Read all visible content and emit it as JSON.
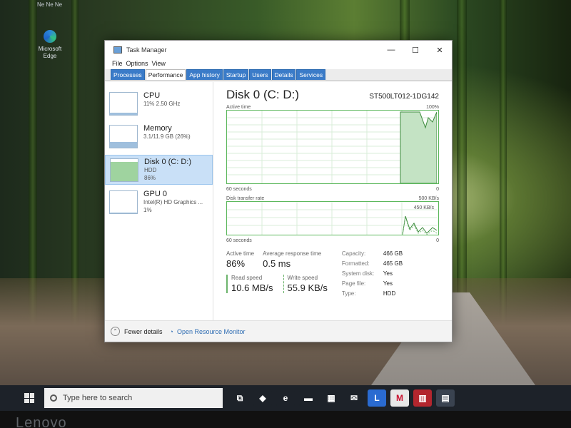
{
  "desktop": {
    "ghost_text": "Ne Ne Ne",
    "icon_label": "Microsoft Edge"
  },
  "window": {
    "title": "Task Manager",
    "controls": [
      "—",
      "☐",
      "✕"
    ],
    "menu": [
      "File",
      "Options",
      "View"
    ],
    "tabs": [
      {
        "label": "Processes"
      },
      {
        "label": "Performance",
        "active": true
      },
      {
        "label": "App history"
      },
      {
        "label": "Startup"
      },
      {
        "label": "Users"
      },
      {
        "label": "Details"
      },
      {
        "label": "Services"
      }
    ]
  },
  "resources": [
    {
      "name": "CPU",
      "line1": "11% 2.50 GHz",
      "line2": "",
      "level": 0.11
    },
    {
      "name": "Memory",
      "line1": "3.1/11.9 GB (26%)",
      "line2": "",
      "level": 0.26
    },
    {
      "name": "Disk 0 (C: D:)",
      "line1": "HDD",
      "line2": "86%",
      "level": 0.86,
      "selected": true
    },
    {
      "name": "GPU 0",
      "line1": "Intel(R) HD Graphics ...",
      "line2": "1%",
      "level": 0.01
    }
  ],
  "detail": {
    "title": "Disk 0 (C: D:)",
    "model": "ST500LT012-1DG142",
    "graph1": {
      "label": "Active time",
      "max_label": "100%",
      "left_label": "60 seconds",
      "right_label": "0"
    },
    "graph2": {
      "label": "Disk transfer rate",
      "max_label": "500 KB/s",
      "inner_label": "450 KB/s",
      "left_label": "60 seconds",
      "right_label": "0"
    },
    "active_time_label": "Active time",
    "active_time_value": "86%",
    "avg_response_label": "Average response time",
    "avg_response_value": "0.5 ms",
    "read_label": "Read speed",
    "read_value": "10.6 MB/s",
    "write_label": "Write speed",
    "write_value": "55.9 KB/s",
    "props": [
      {
        "k": "Capacity:",
        "v": "466 GB"
      },
      {
        "k": "Formatted:",
        "v": "465 GB"
      },
      {
        "k": "System disk:",
        "v": "Yes"
      },
      {
        "k": "Page file:",
        "v": "Yes"
      },
      {
        "k": "Type:",
        "v": "HDD"
      }
    ]
  },
  "footer": {
    "fewer_details": "Fewer details",
    "resource_monitor": "Open Resource Monitor"
  },
  "taskbar": {
    "search_placeholder": "Type here to search",
    "icons": [
      {
        "name": "task-view-icon",
        "glyph": "⧉",
        "color": "#1d2229"
      },
      {
        "name": "copilot-icon",
        "glyph": "◆",
        "color": "#1d2229"
      },
      {
        "name": "edge-icon",
        "glyph": "e",
        "color": "#1d2229"
      },
      {
        "name": "file-explorer-icon",
        "glyph": "▬",
        "color": "#1d2229"
      },
      {
        "name": "store-icon",
        "glyph": "▦",
        "color": "#1d2229"
      },
      {
        "name": "mail-icon",
        "glyph": "✉",
        "color": "#1d2229"
      },
      {
        "name": "lenovo-vantage-icon",
        "glyph": "L",
        "color": "#2a6bd1"
      },
      {
        "name": "mcafee-icon",
        "glyph": "M",
        "color": "#e8e8e8"
      },
      {
        "name": "red-app-icon",
        "glyph": "▥",
        "color": "#b3262e"
      },
      {
        "name": "task-manager-icon",
        "glyph": "▤",
        "color": "#3a4350"
      }
    ]
  },
  "bezel_brand": "Lenovo",
  "colors": {
    "accent": "#3a7bc8",
    "disk_green": "#5cb85c",
    "selection": "#c9e0f7"
  }
}
